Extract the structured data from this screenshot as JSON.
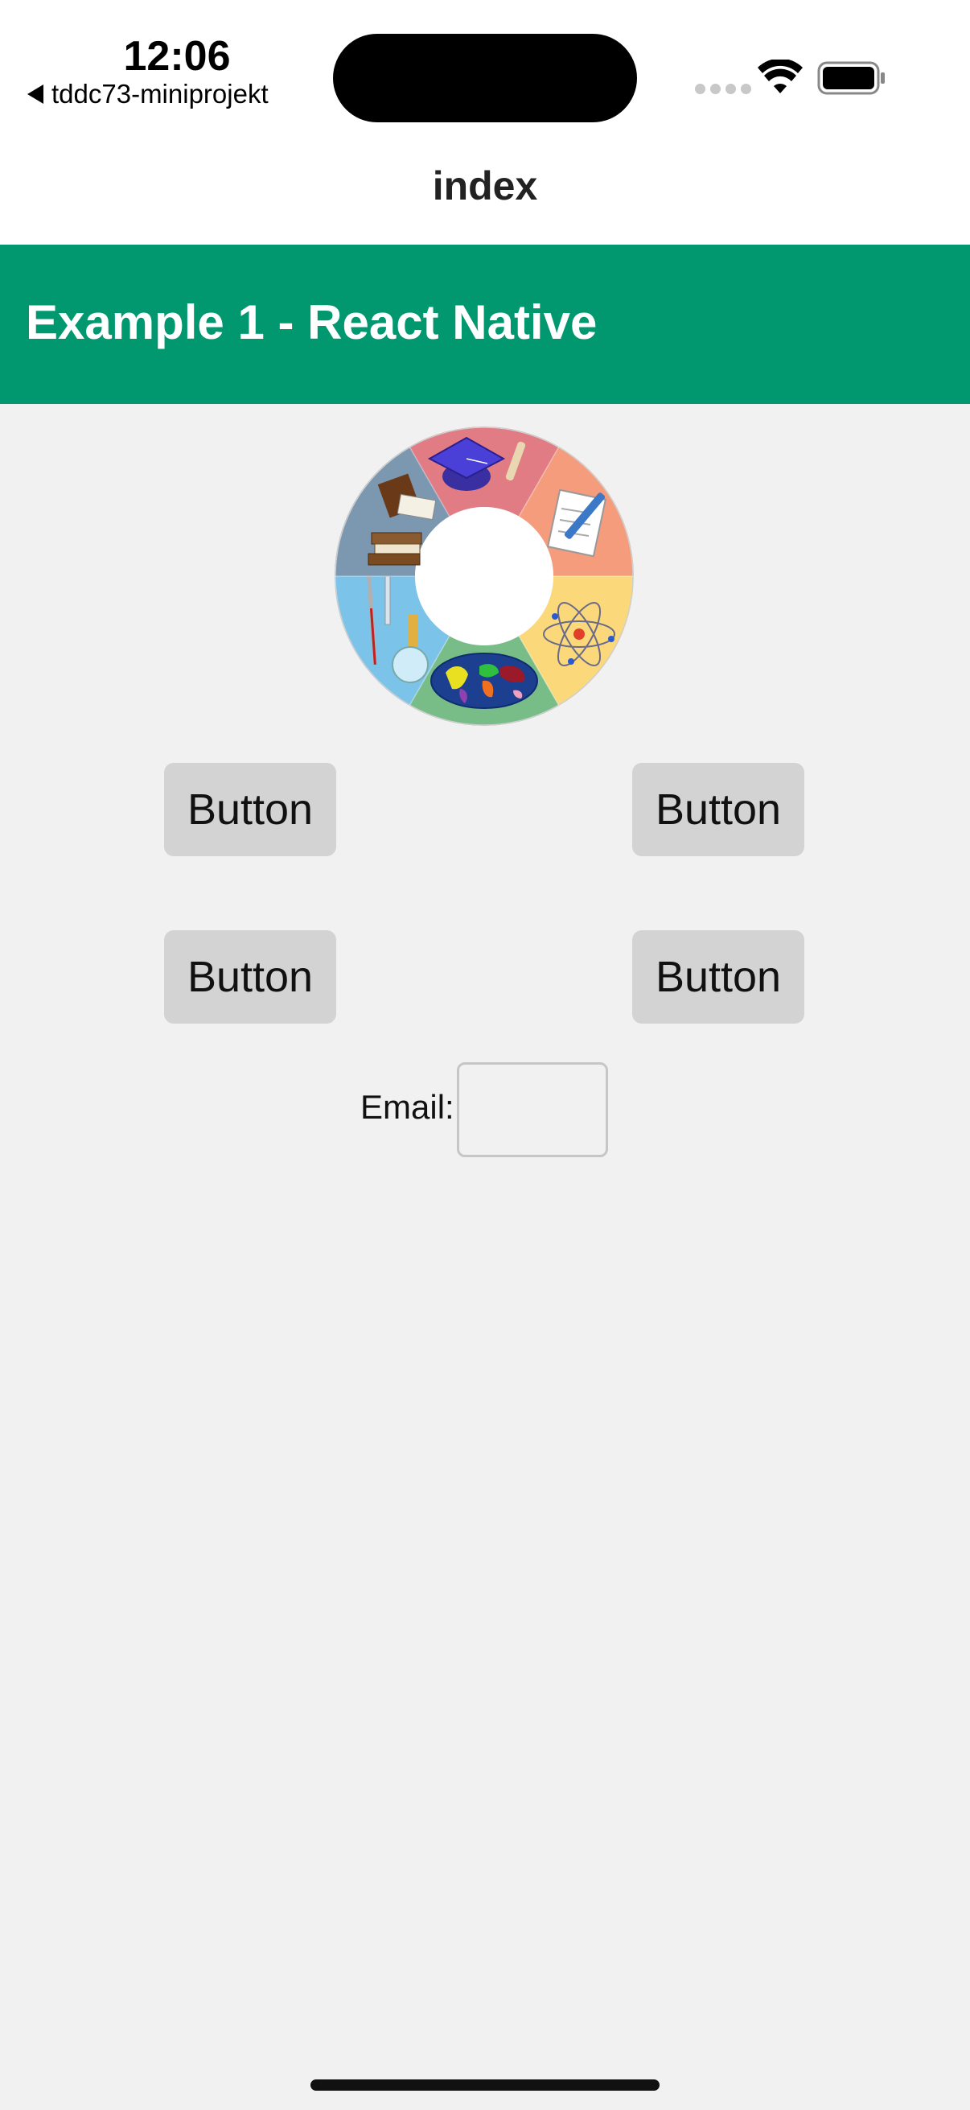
{
  "status_bar": {
    "time": "12:06",
    "back_app": "tddc73-miniprojekt",
    "icons": [
      "back-arrow-icon",
      "signal-icon",
      "wifi-icon",
      "battery-icon"
    ]
  },
  "nav": {
    "title": "index"
  },
  "header": {
    "title": "Example 1 - React Native",
    "background_color": "#019870"
  },
  "wheel": {
    "icon": "education-subjects-wheel-icon",
    "segments": [
      "graduation-cap",
      "paper-pencil",
      "atom",
      "globe",
      "laboratory",
      "books"
    ]
  },
  "buttons": [
    {
      "label": "Button"
    },
    {
      "label": "Button"
    },
    {
      "label": "Button"
    },
    {
      "label": "Button"
    }
  ],
  "form": {
    "email_label": "Email:",
    "email_value": "",
    "email_placeholder": ""
  },
  "colors": {
    "background": "#f1f1f1",
    "button": "#d3d3d3",
    "header": "#019870"
  }
}
